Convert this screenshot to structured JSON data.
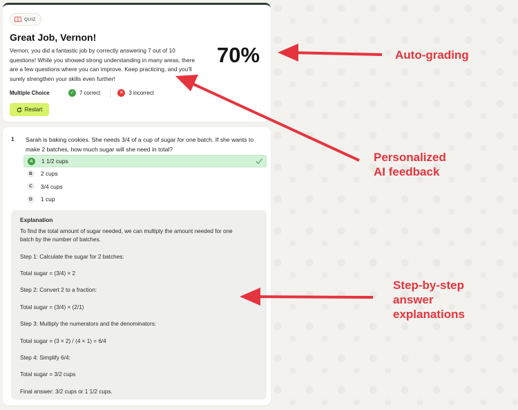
{
  "badge": {
    "label": "QUIZ",
    "icon": "book-icon"
  },
  "result": {
    "title": "Great Job, Vernon!",
    "feedback": "Vernon, you did a fantastic job by correctly answering 7 out of 10 questions! While you showed strong understanding in many areas, there are a few questions where you can improve. Keep practicing, and you'll surely strengthen your skills even further!",
    "percent": "70%",
    "stat_label": "Multiple Choice",
    "correct": "7 correct",
    "incorrect": "3 incorrect",
    "restart_label": "Restart"
  },
  "question": {
    "number": "1",
    "text": "Sarah is baking cookies. She needs 3/4 of a cup of sugar for one batch. If she wants to make 2 batches, how much sugar will she need in total?",
    "options": [
      {
        "letter": "A",
        "label": "1 1/2 cups"
      },
      {
        "letter": "B",
        "label": "2 cups"
      },
      {
        "letter": "C",
        "label": "3/4 cups"
      },
      {
        "letter": "D",
        "label": "1 cup"
      }
    ],
    "correct_index": 0
  },
  "explanation": {
    "title": "Explanation",
    "lines": [
      "To find the total amount of sugar needed, we can multiply the amount needed for one",
      "batch by the number of batches.",
      "",
      "Step 1: Calculate the sugar for 2 batches:",
      "",
      "Total sugar = (3/4) × 2",
      "",
      "Step 2: Convert 2 to a fraction:",
      "",
      "Total sugar = (3/4) × (2/1)",
      "",
      "Step 3: Multiply the numerators and the denominators:",
      "",
      "Total sugar = (3 × 2) / (4 × 1) = 6/4",
      "",
      "Step 4: Simplify 6/4:",
      "",
      "Total sugar = 3/2 cups",
      "",
      "Final answer: 3/2 cups or 1 1/2 cups."
    ]
  },
  "annotations": {
    "auto_grading": "Auto-grading",
    "feedback_line1": "Personalized",
    "feedback_line2": "AI feedback",
    "steps_line1": "Step-by-step",
    "steps_line2": "answer",
    "steps_line3": "explanations"
  },
  "colors": {
    "accent_red": "#e5343e",
    "restart_green": "#d8f26a",
    "correct_green": "#43a047",
    "incorrect_red": "#e53935"
  }
}
